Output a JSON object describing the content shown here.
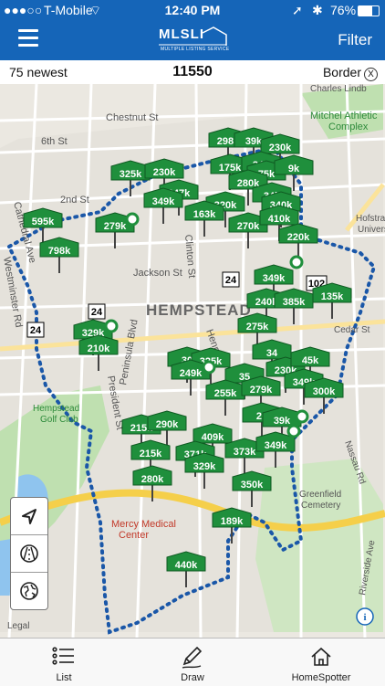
{
  "status": {
    "carrier": "T-Mobile",
    "time": "12:40 PM",
    "battery": "76%"
  },
  "nav": {
    "logo": "MLSLI",
    "logo_sub": "MULTIPLE LISTING SERVICE",
    "filter": "Filter"
  },
  "info": {
    "newest": "75 newest",
    "count": "11550",
    "border": "Border",
    "close": "X"
  },
  "map": {
    "labels": [
      "Chestnut St",
      "6th St",
      "Cathedral Ave",
      "2nd St",
      "Westminster Rd",
      "Jackson St",
      "Clinton St",
      "HEMPSTEAD",
      "Henry St",
      "President St",
      "Peninsula Blvd",
      "Hempstead",
      "Golf Club",
      "Mercy Medical",
      "Center",
      "Greenfield",
      "Cemetery",
      "Nassau Rd",
      "Mitchel Athletic",
      "Complex",
      "Charles Lindb",
      "Hofstra",
      "University",
      "Cedar St",
      "Riverside Ave",
      "Legal",
      "24",
      "24",
      "24",
      "102"
    ],
    "prices": [
      "298k",
      "39k",
      "230k",
      "175k",
      "34k",
      "75k",
      "9k",
      "325k",
      "230k",
      "347k",
      "349k",
      "280k",
      "34k",
      "320k",
      "340k",
      "163k",
      "270k",
      "410k",
      "279k",
      "595k",
      "220k",
      "798k",
      "349k",
      "240k",
      "385k",
      "135k",
      "275k",
      "329k",
      "210k",
      "30",
      "325k",
      "249k",
      "35",
      "255k",
      "279k",
      "34",
      "230k",
      "45k",
      "349k",
      "300k",
      "26",
      "39k",
      "215k",
      "290k",
      "409k",
      "373k",
      "349k",
      "215k",
      "371k",
      "329k",
      "280k",
      "350k",
      "189k",
      "440k"
    ]
  },
  "tools": [
    "location-arrow-icon",
    "road-icon",
    "globe-icon"
  ],
  "tabs": {
    "list": "List",
    "draw": "Draw",
    "homespotter": "HomeSpotter"
  },
  "colors": {
    "brand": "#1565b8",
    "pin": "#1f8f3c",
    "pin_border": "#0f5a22",
    "border_line": "#1a57a8"
  }
}
